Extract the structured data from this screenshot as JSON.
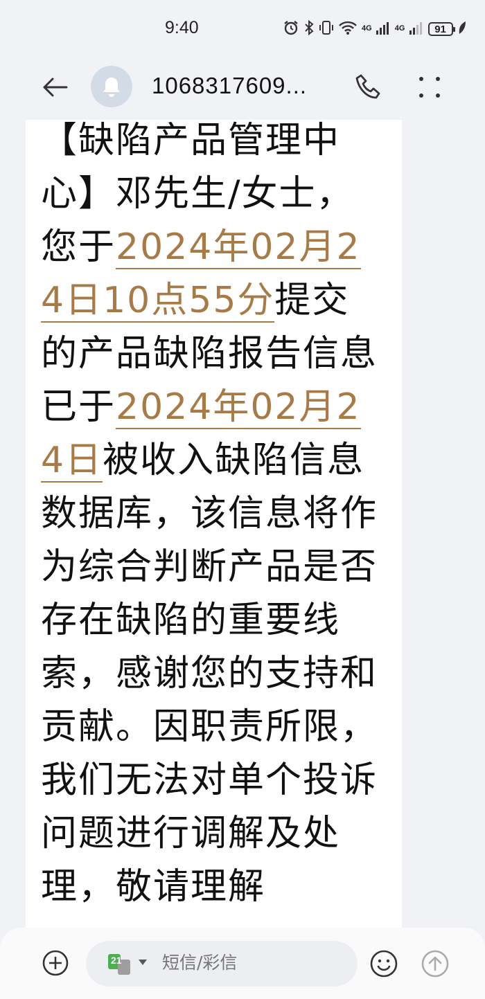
{
  "status_bar": {
    "time": "9:40",
    "network_1": "4G",
    "network_2": "4G",
    "battery": "91",
    "icons": [
      "alarm-icon",
      "bluetooth-icon",
      "vibrate-icon",
      "wifi-icon",
      "signal-icon",
      "signal-icon",
      "battery-icon",
      "leaf-icon"
    ]
  },
  "header": {
    "contact": "1068317609...",
    "icons": [
      "back-arrow-icon",
      "bell-icon",
      "phone-icon",
      "more-dots-icon"
    ]
  },
  "message": {
    "seg1": "【缺陷产品管理中心】邓先生/女士，您于",
    "date1": "2024年02月24日10点55分",
    "seg2": "提交的产品缺陷报告信息已于",
    "date2": "2024年02月24日",
    "seg3": "被收入缺陷信息数据库，该信息将作为综合判断产品是否存在缺陷的重要线索，感谢您的支持和贡献。因职责所限，我们无法对单个投诉问题进行调解及",
    "seg4_partial": "处理，敬请理解",
    "link_color": "#a87a45"
  },
  "input_bar": {
    "sim_badge": "21",
    "placeholder": "短信/彩信",
    "icons": [
      "plus-circle-icon",
      "sim-card-icon",
      "emoji-icon",
      "send-arrow-icon"
    ]
  }
}
